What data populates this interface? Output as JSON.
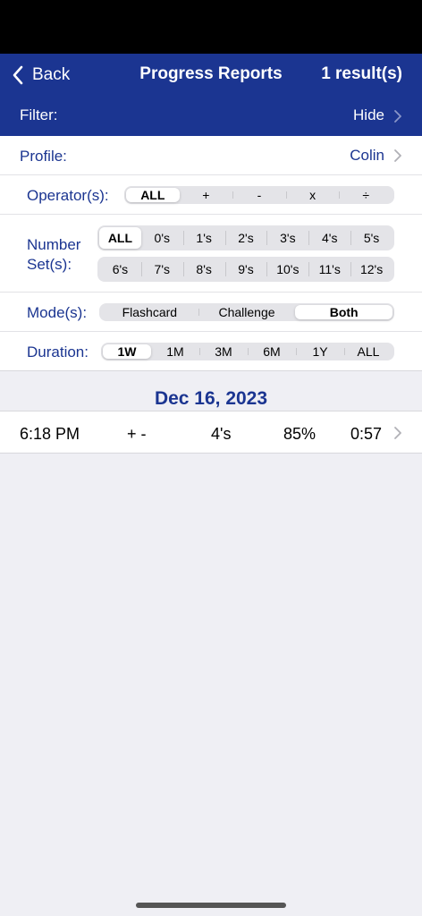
{
  "navbar": {
    "back_label": "Back",
    "title": "Progress Reports",
    "results": "1 result(s)",
    "filter_label": "Filter:",
    "hide_label": "Hide"
  },
  "filters": {
    "profile": {
      "label": "Profile:",
      "value": "Colin"
    },
    "operators": {
      "label": "Operator(s):",
      "options": [
        "ALL",
        "+",
        "-",
        "x",
        "÷"
      ],
      "selected": "ALL"
    },
    "number_sets": {
      "label_line1": "Number",
      "label_line2": "Set(s):",
      "row1": [
        "ALL",
        "0's",
        "1's",
        "2's",
        "3's",
        "4's",
        "5's"
      ],
      "row2": [
        "6's",
        "7's",
        "8's",
        "9's",
        "10's",
        "11's",
        "12's"
      ],
      "selected": "ALL"
    },
    "modes": {
      "label": "Mode(s):",
      "options": [
        "Flashcard",
        "Challenge",
        "Both"
      ],
      "selected": "Both"
    },
    "duration": {
      "label": "Duration:",
      "options": [
        "1W",
        "1M",
        "3M",
        "6M",
        "1Y",
        "ALL"
      ],
      "selected": "1W"
    }
  },
  "results": {
    "date": "Dec 16, 2023",
    "rows": [
      {
        "time": "6:18 PM",
        "operators": "+ -",
        "number_set": "4's",
        "score": "85%",
        "duration": "0:57"
      }
    ]
  },
  "colors": {
    "accent": "#1b3591",
    "background": "#efeff4"
  }
}
